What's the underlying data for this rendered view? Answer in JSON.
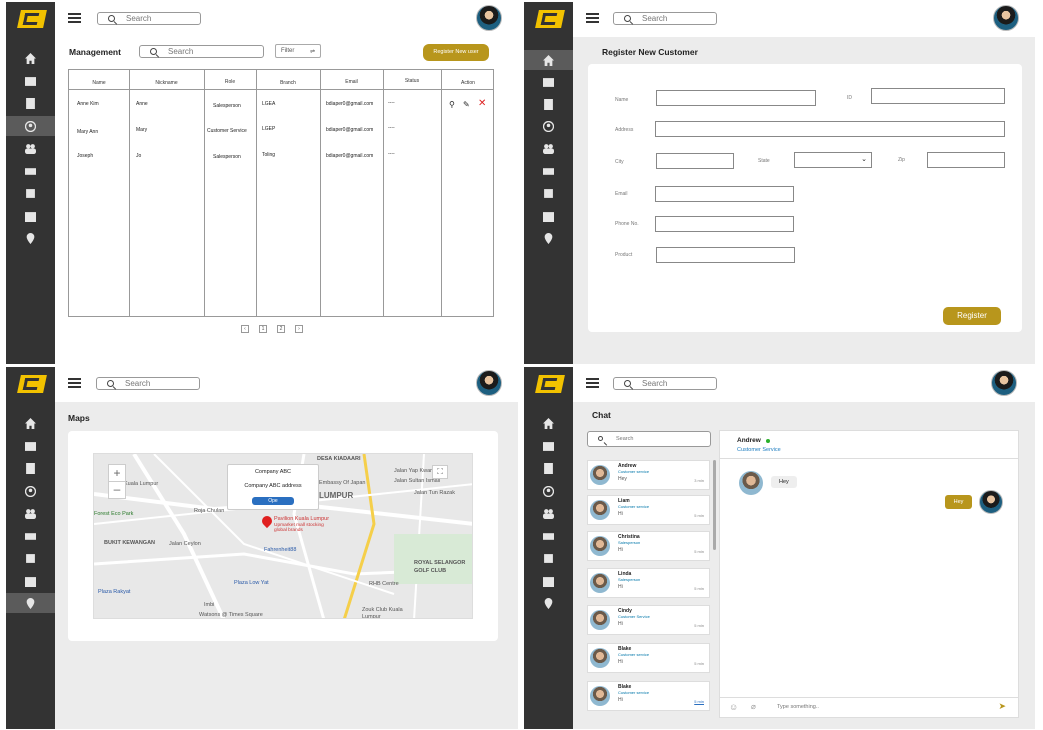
{
  "app": {
    "search_placeholder": "Search"
  },
  "management": {
    "title": "Management",
    "search_placeholder": "Search",
    "filter_label": "Filter",
    "register_button": "Register New user",
    "columns": [
      "Name",
      "Nickname",
      "Role",
      "Branch",
      "Email",
      "Status",
      "Action"
    ],
    "rows": [
      [
        "Anne Kim",
        "Anne",
        "Salesperson",
        "LGEA",
        "bdiaper0@gmail.com",
        "----"
      ],
      [
        "Mary Ann",
        "Mary",
        "Customer Service",
        "LGEP",
        "bdiaper0@gmail.com",
        "----"
      ],
      [
        "Joseph",
        "Jo",
        "Salesperson",
        "Toling",
        "bdiaper0@gmail.com",
        "----"
      ]
    ],
    "pages": [
      "‹",
      "1",
      "2",
      "›"
    ]
  },
  "register": {
    "title": "Register New Customer",
    "labels": {
      "name": "Name",
      "id": "ID",
      "address": "Address",
      "city": "City",
      "state": "State",
      "zip": "Zip",
      "email": "Email",
      "phone": "Phone No.",
      "product": "Product"
    },
    "button": "Register"
  },
  "maps": {
    "title": "Maps",
    "popup_name": "Company ABC",
    "popup_address": "Company ABC address",
    "popup_button": "Ope",
    "places": [
      "DESA KIADAARI",
      "Jalan Yap Kwan Seng",
      "Kuala Lumpur",
      "Embassy Of Japan",
      "LUMPUR",
      "Forest Eco Park",
      "Roja Chulan",
      "Pavilion Kuala Lumpur",
      "Upmarket mall stocking global brands",
      "Fahrenheit88",
      "BUKIT KEWANGAN",
      "Jalan Ceylon",
      "ROYAL SELANGOR GOLF CLUB",
      "Plaza Low Yat",
      "RHB Centre",
      "Plaza Rakyat",
      "Imbi",
      "Watsons @ Times Square",
      "Zouk Club Kuala Lumpur",
      "Jalan Sultan Ismail",
      "Jalan Tun Razak"
    ]
  },
  "chat": {
    "title": "Chat",
    "search_placeholder": "Search",
    "contacts": [
      {
        "name": "Andrew",
        "role": "Customer service",
        "msg": "Hey",
        "time": "3 min"
      },
      {
        "name": "Liam",
        "role": "Customer service",
        "msg": "Hi",
        "time": "5 min"
      },
      {
        "name": "Christina",
        "role": "Salesperson",
        "msg": "Hi",
        "time": "5 min"
      },
      {
        "name": "Linda",
        "role": "Salesperson",
        "msg": "Hi",
        "time": "5 min"
      },
      {
        "name": "Cindy",
        "role": "Customer Service",
        "msg": "Hi",
        "time": "5 min"
      },
      {
        "name": "Blake",
        "role": "Customer service",
        "msg": "Hi",
        "time": "5 min"
      },
      {
        "name": "Blake",
        "role": "Customer service",
        "msg": "Hi",
        "time": "5 min"
      }
    ],
    "active_name": "Andrew",
    "active_role": "Customer Service",
    "incoming": "Hey",
    "outgoing": "Hey",
    "input_placeholder": "Type something.."
  }
}
